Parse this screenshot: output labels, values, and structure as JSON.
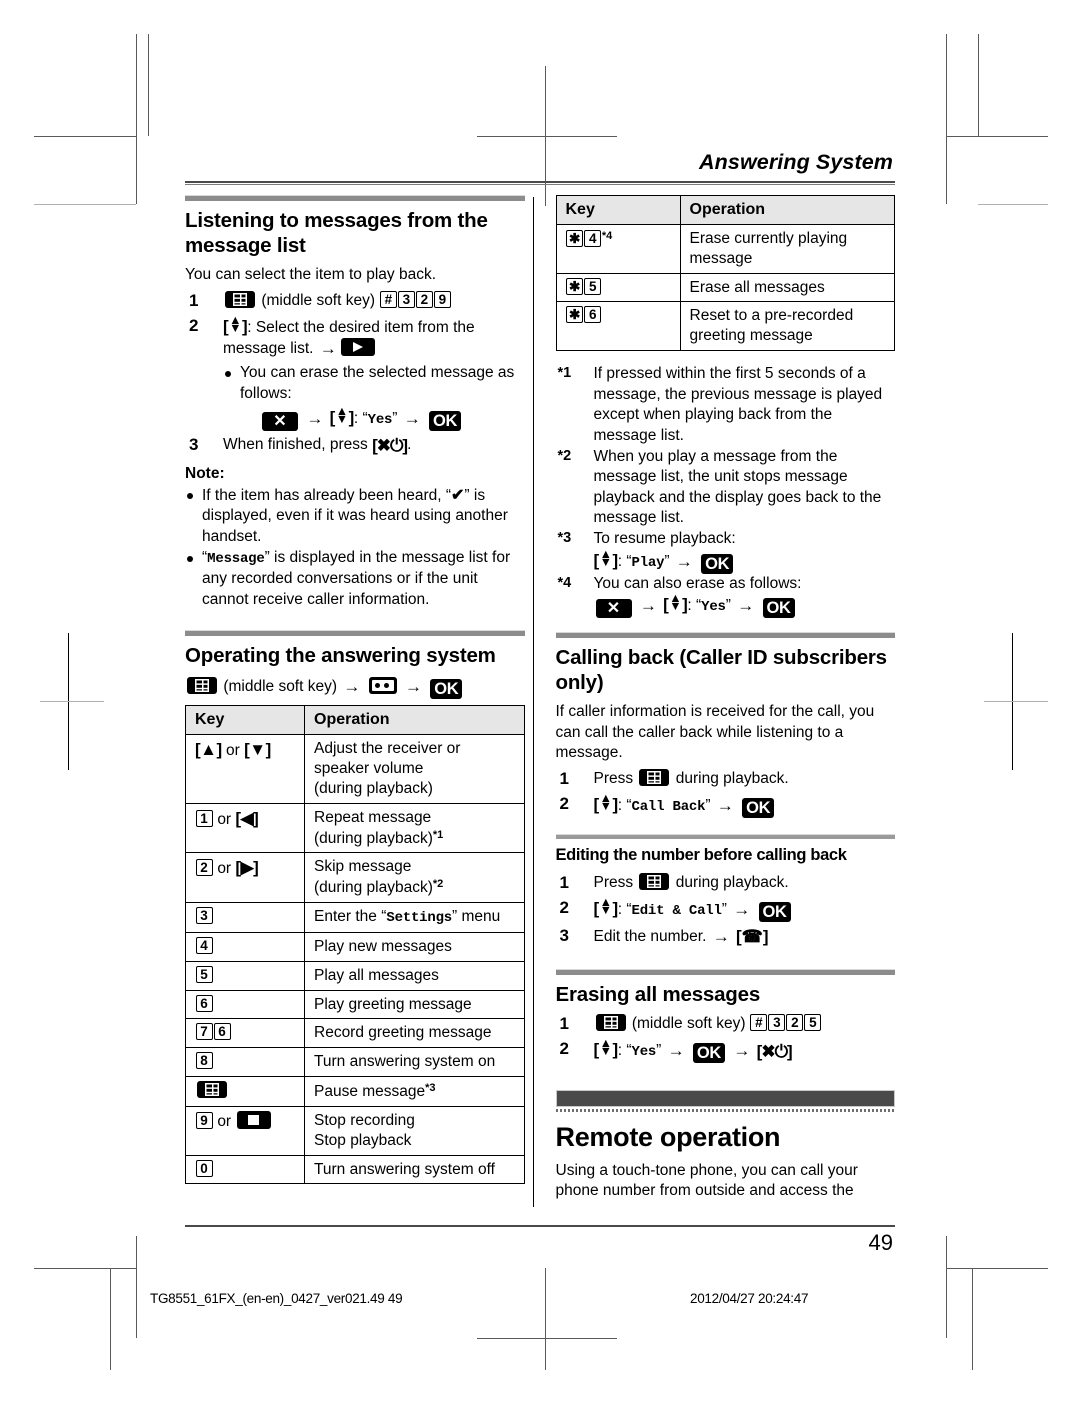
{
  "runhead": "Answering System",
  "page_number": "49",
  "left_column": {
    "section1": {
      "title": "Listening to messages from the message list",
      "intro": "You can select the item to play back.",
      "steps": [
        {
          "num": "1",
          "text_parts": [
            "(middle soft key)"
          ],
          "keys": "# 3 2 9"
        },
        {
          "num": "2",
          "text": ": Select the desired item from the message list."
        }
      ],
      "step2_bullet": "You can erase the selected message as follows:",
      "step2_seq_yes": "Yes",
      "step3_num": "3",
      "step3_text": "When finished, press",
      "note_label": "Note:",
      "notes": [
        "If the item has already been heard, “✓” is displayed, even if it was heard using another handset.",
        "“Message” is displayed in the message list for any recorded conversations or if the unit cannot receive caller information."
      ],
      "note2_mono": "Message"
    },
    "section2": {
      "title": "Operating the answering system",
      "access_label": "(middle soft key)",
      "table": {
        "headers": [
          "Key",
          "Operation"
        ],
        "rows": [
          {
            "key_type": "updown_ab",
            "key_text": "or",
            "op": "Adjust the receiver or speaker volume (during playback)"
          },
          {
            "key_type": "num_or_left",
            "key_num": "1",
            "key_text": "or",
            "op": "Repeat message (during playback)",
            "op_sup": "*1"
          },
          {
            "key_type": "num_or_right",
            "key_num": "2",
            "key_text": "or",
            "op": "Skip message (during playback)",
            "op_sup": "*2"
          },
          {
            "key_type": "num",
            "key_num": "3",
            "op_pre": "Enter the “",
            "op_mono": "Settings",
            "op_post": "” menu"
          },
          {
            "key_type": "num",
            "key_num": "4",
            "op": "Play new messages"
          },
          {
            "key_type": "num",
            "key_num": "5",
            "op": "Play all messages"
          },
          {
            "key_type": "num",
            "key_num": "6",
            "op": "Play greeting message"
          },
          {
            "key_type": "num2",
            "key_num": "7",
            "key_num2": "6",
            "op": "Record greeting message"
          },
          {
            "key_type": "num",
            "key_num": "8",
            "op": "Turn answering system on"
          },
          {
            "key_type": "softkey",
            "op": "Pause message",
            "op_sup": "*3"
          },
          {
            "key_type": "num_or_stop",
            "key_num": "9",
            "key_text": "or",
            "op": "Stop recording Stop playback",
            "op_line1": "Stop recording",
            "op_line2": "Stop playback"
          },
          {
            "key_type": "num",
            "key_num": "0",
            "op": "Turn answering system off"
          }
        ]
      }
    }
  },
  "right_column": {
    "table": {
      "headers": [
        "Key",
        "Operation"
      ],
      "rows": [
        {
          "key_star": "4",
          "key_sup": "*4",
          "op": "Erase currently playing message"
        },
        {
          "key_star": "5",
          "op": "Erase all messages"
        },
        {
          "key_star": "6",
          "op": "Reset to a pre-recorded greeting message"
        }
      ]
    },
    "footnotes": [
      {
        "mark": "*1",
        "text": "If pressed within the first 5 seconds of a message, the previous message is played except when playing back from the message list."
      },
      {
        "mark": "*2",
        "text": "When you play a message from the message list, the unit stops message playback and the display goes back to the message list."
      },
      {
        "mark": "*3",
        "text": "To resume playback:",
        "seq_word": "Play"
      },
      {
        "mark": "*4",
        "text": "You can also erase as follows:",
        "seq_word": "Yes"
      }
    ],
    "section_callback": {
      "title": "Calling back (Caller ID subscribers only)",
      "intro": "If caller information is received for the call, you can call the caller back while listening to a message.",
      "steps": [
        {
          "num": "1",
          "pre": "Press",
          "post": "during playback."
        },
        {
          "num": "2",
          "word": "Call Back"
        }
      ]
    },
    "section_editing": {
      "title": "Editing the number before calling back",
      "steps": [
        {
          "num": "1",
          "pre": "Press",
          "post": "during playback."
        },
        {
          "num": "2",
          "word": "Edit & Call"
        },
        {
          "num": "3",
          "text": "Edit the number."
        }
      ]
    },
    "section_erasing": {
      "title": "Erasing all messages",
      "steps": [
        {
          "num": "1",
          "label": "(middle soft key)",
          "keys": "# 3 2 5"
        },
        {
          "num": "2",
          "word": "Yes"
        }
      ]
    },
    "chapter": {
      "title": "Remote operation",
      "intro": "Using a touch-tone phone, you can call your phone number from outside and access the"
    }
  },
  "imprint": {
    "left": "TG8551_61FX_(en-en)_0427_ver021.49    49",
    "right": "2012/04/27    20:24:47"
  }
}
